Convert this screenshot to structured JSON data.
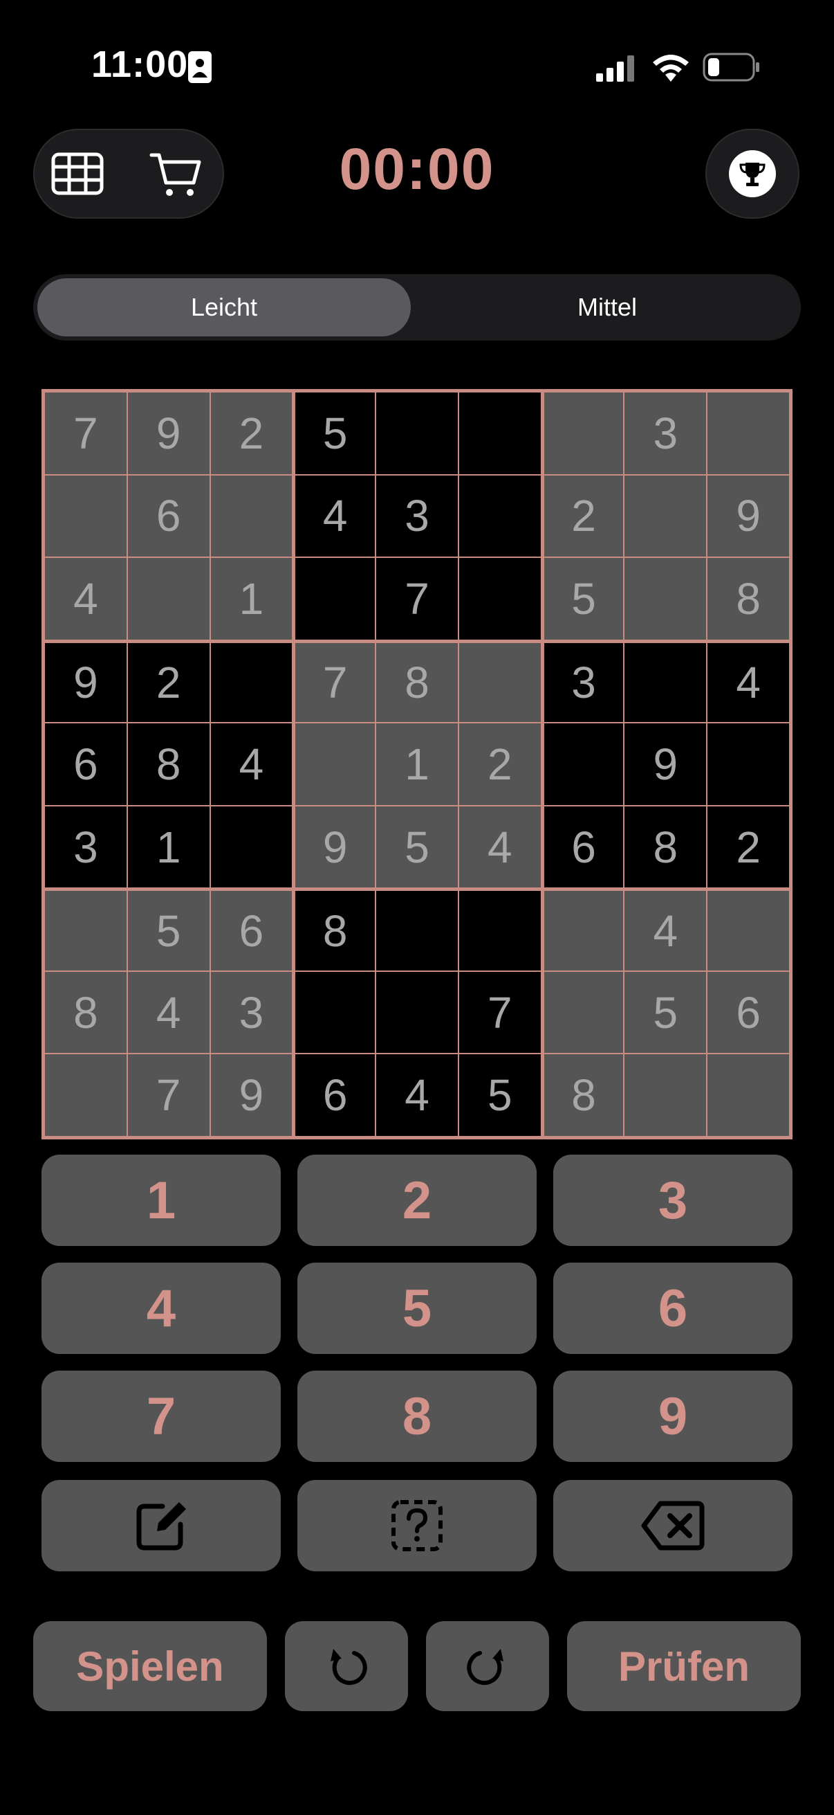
{
  "status": {
    "time": "11:00"
  },
  "timer": "00:00",
  "tabs": [
    {
      "label": "Leicht",
      "selected": true
    },
    {
      "label": "Mittel",
      "selected": false
    }
  ],
  "board": [
    [
      "7",
      "9",
      "2",
      "5",
      "",
      "",
      "",
      "3",
      ""
    ],
    [
      "",
      "6",
      "",
      "4",
      "3",
      "",
      "2",
      "",
      "9"
    ],
    [
      "4",
      "",
      "1",
      "",
      "7",
      "",
      "5",
      "",
      "8"
    ],
    [
      "9",
      "2",
      "",
      "7",
      "8",
      "",
      "3",
      "",
      "4"
    ],
    [
      "6",
      "8",
      "4",
      "",
      "1",
      "2",
      "",
      "9",
      ""
    ],
    [
      "3",
      "1",
      "",
      "9",
      "5",
      "4",
      "6",
      "8",
      "2"
    ],
    [
      "",
      "5",
      "6",
      "8",
      "",
      "",
      "",
      "4",
      ""
    ],
    [
      "8",
      "4",
      "3",
      "",
      "",
      "7",
      "",
      "5",
      "6"
    ],
    [
      "",
      "7",
      "9",
      "6",
      "4",
      "5",
      "8",
      "",
      ""
    ]
  ],
  "keypad": [
    "1",
    "2",
    "3",
    "4",
    "5",
    "6",
    "7",
    "8",
    "9"
  ],
  "tools": {
    "notes_icon": "pencil-square-icon",
    "hint_icon": "hint-question-icon",
    "erase_icon": "backspace-x-icon"
  },
  "bottom": {
    "play_label": "Spielen",
    "check_label": "Prüfen"
  },
  "colors": {
    "accent": "#d4938a",
    "grid": "#c98c83",
    "shade": "#555555",
    "background": "#000000"
  }
}
